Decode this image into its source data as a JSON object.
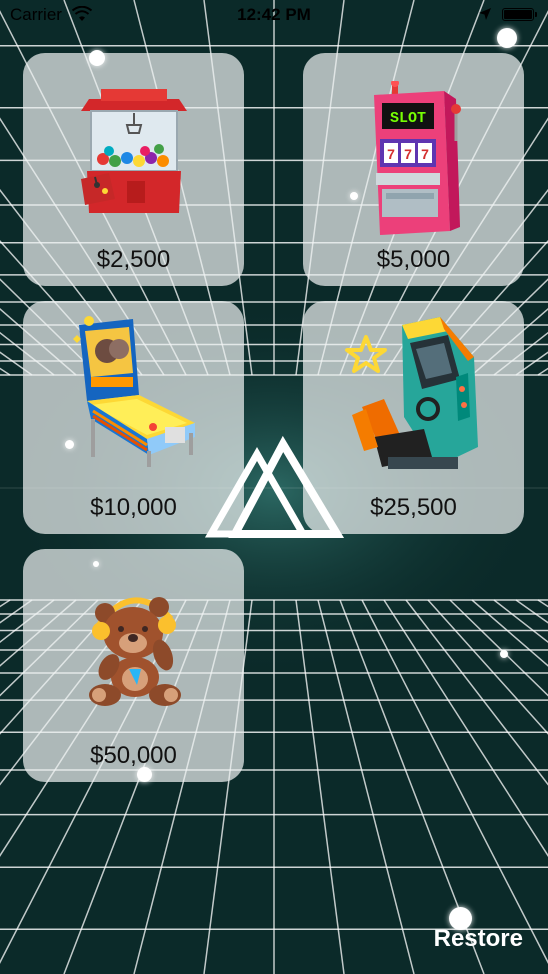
{
  "status_bar": {
    "carrier": "Carrier",
    "time": "12:42 PM"
  },
  "products": [
    {
      "price": "$2,500",
      "icon": "claw-machine-icon"
    },
    {
      "price": "$5,000",
      "icon": "slot-machine-icon"
    },
    {
      "price": "$10,000",
      "icon": "pinball-machine-icon"
    },
    {
      "price": "$25,500",
      "icon": "arcade-racing-cabinet-icon"
    },
    {
      "price": "$50,000",
      "icon": "teddy-bear-headphones-icon"
    }
  ],
  "footer": {
    "restore_label": "Restore"
  },
  "colors": {
    "background": "#0b2a29",
    "grid_line": "#ffffff",
    "card": "#ebf0f0"
  }
}
